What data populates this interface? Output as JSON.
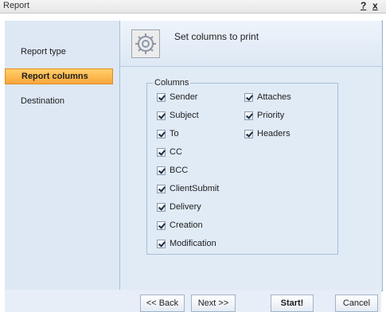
{
  "window": {
    "title": "Report",
    "help_label": "?",
    "close_label": "x"
  },
  "sidebar": {
    "items": [
      {
        "label": "Report type",
        "active": false
      },
      {
        "label": "Report columns",
        "active": true
      },
      {
        "label": "Destination",
        "active": false
      }
    ]
  },
  "header": {
    "icon": "gear-icon",
    "text": "Set columns to print"
  },
  "columns_group": {
    "legend": "Columns",
    "left": [
      "Sender",
      "Subject",
      "To",
      "CC",
      "BCC",
      "ClientSubmit",
      "Delivery",
      "Creation",
      "Modification"
    ],
    "right": [
      "Attaches",
      "Priority",
      "Headers"
    ],
    "checked": true
  },
  "footer": {
    "back": "<< Back",
    "next": "Next >>",
    "start": "Start!",
    "cancel": "Cancel"
  },
  "colors": {
    "active_item": "#f8a63a",
    "panel_bg": "#e1ebf6"
  }
}
